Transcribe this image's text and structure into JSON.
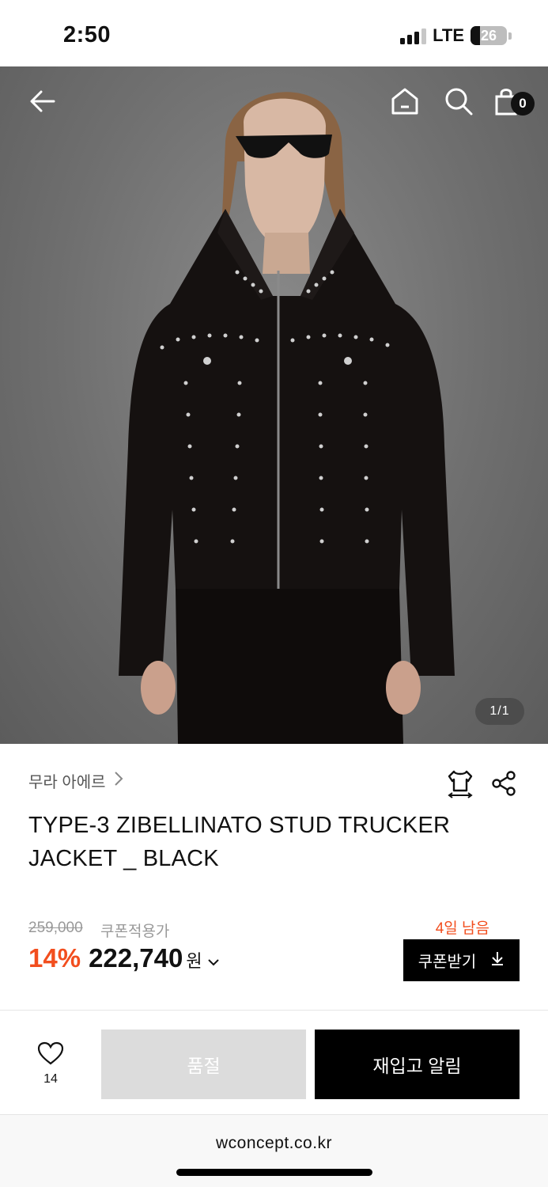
{
  "status_bar": {
    "time": "2:50",
    "network": "LTE",
    "battery": "26",
    "battery_level": 0.26
  },
  "hero": {
    "pager": "1/1",
    "cart_count": "0"
  },
  "product": {
    "brand": "무라 아에르",
    "title": "TYPE-3 ZIBELLINATO STUD TRUCKER JACKET _ BLACK",
    "original_price": "259,000",
    "coupon_note": "쿠폰적용가",
    "discount": "14%",
    "price": "222,740",
    "currency": "원",
    "days_left": "4일 남음",
    "coupon_button": "쿠폰받기"
  },
  "actions": {
    "like_count": "14",
    "soldout": "품절",
    "restock": "재입고 알림"
  },
  "browser": {
    "url": "wconcept.co.kr"
  },
  "colors": {
    "accent": "#f24e1e",
    "primary": "#000000",
    "disabled": "#dcdcdc"
  },
  "icons": [
    "back-arrow-icon",
    "home-icon",
    "search-icon",
    "shopping-bag-icon",
    "size-guide-icon",
    "share-icon",
    "heart-icon",
    "download-icon",
    "chevron-right-icon",
    "chevron-down-icon"
  ]
}
